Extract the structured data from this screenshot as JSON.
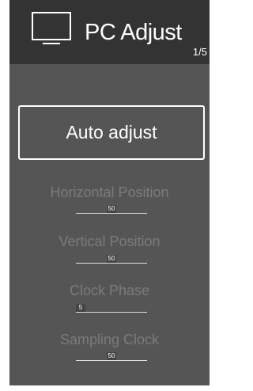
{
  "header": {
    "title": "PC Adjust",
    "page_indicator": "1/5",
    "icon": "monitor-icon"
  },
  "auto_adjust": {
    "label": "Auto adjust"
  },
  "settings": [
    {
      "label": "Horizontal Position",
      "value": "50",
      "fraction": 0.5
    },
    {
      "label": "Vertical Position",
      "value": "50",
      "fraction": 0.5
    },
    {
      "label": "Clock Phase",
      "value": "5",
      "fraction": 0.05
    },
    {
      "label": "Sampling Clock",
      "value": "50",
      "fraction": 0.5
    }
  ],
  "colors": {
    "panel": "#555555",
    "header": "#333333",
    "text": "#ffffff",
    "inactive_text": "#7b7b7b"
  }
}
